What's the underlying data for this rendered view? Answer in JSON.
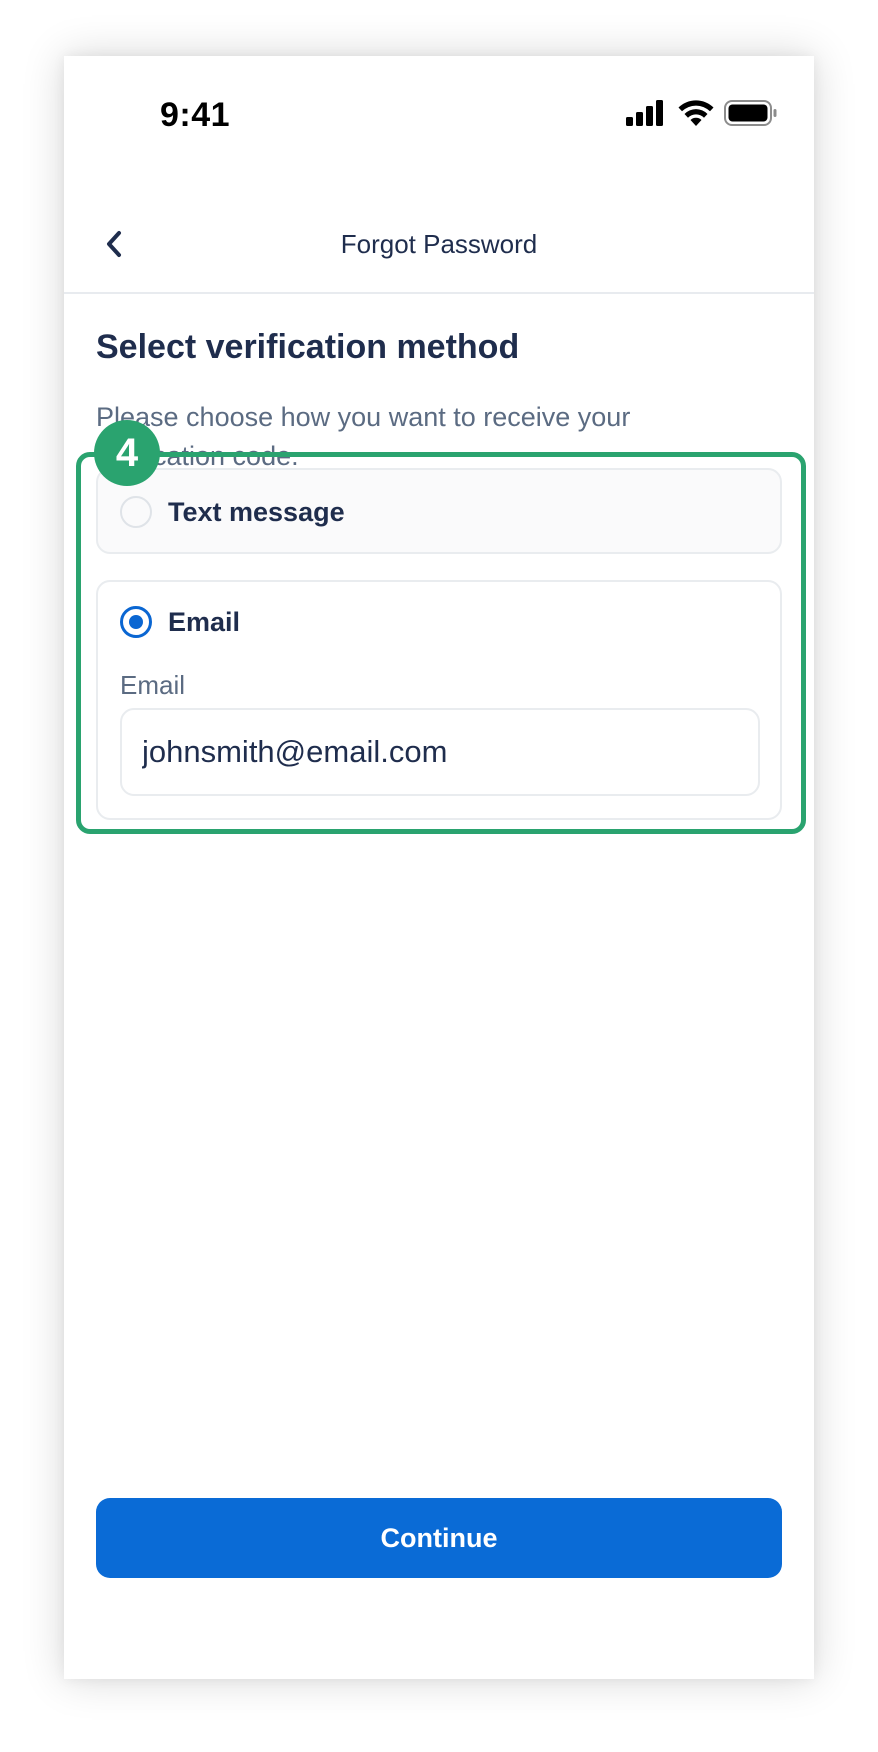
{
  "status_bar": {
    "time": "9:41",
    "icons": [
      "cellular-signal-icon",
      "wifi-icon",
      "battery-icon"
    ]
  },
  "nav": {
    "back_icon": "chevron-left-icon",
    "title": "Forgot Password"
  },
  "main": {
    "heading": "Select verification method",
    "description": "Please choose how you want to receive your verification code.",
    "options": [
      {
        "label": "Text message",
        "selected": false
      },
      {
        "label": "Email",
        "selected": true
      }
    ],
    "email_field": {
      "label": "Email",
      "value": "johnsmith@email.com"
    }
  },
  "annotation": {
    "step_number": "4",
    "color": "#2aa36f"
  },
  "footer": {
    "continue_label": "Continue"
  },
  "colors": {
    "primary": "#0a6bd6",
    "text_dark": "#1f2d4d",
    "text_muted": "#5b6b82",
    "annotation_green": "#2aa36f"
  }
}
